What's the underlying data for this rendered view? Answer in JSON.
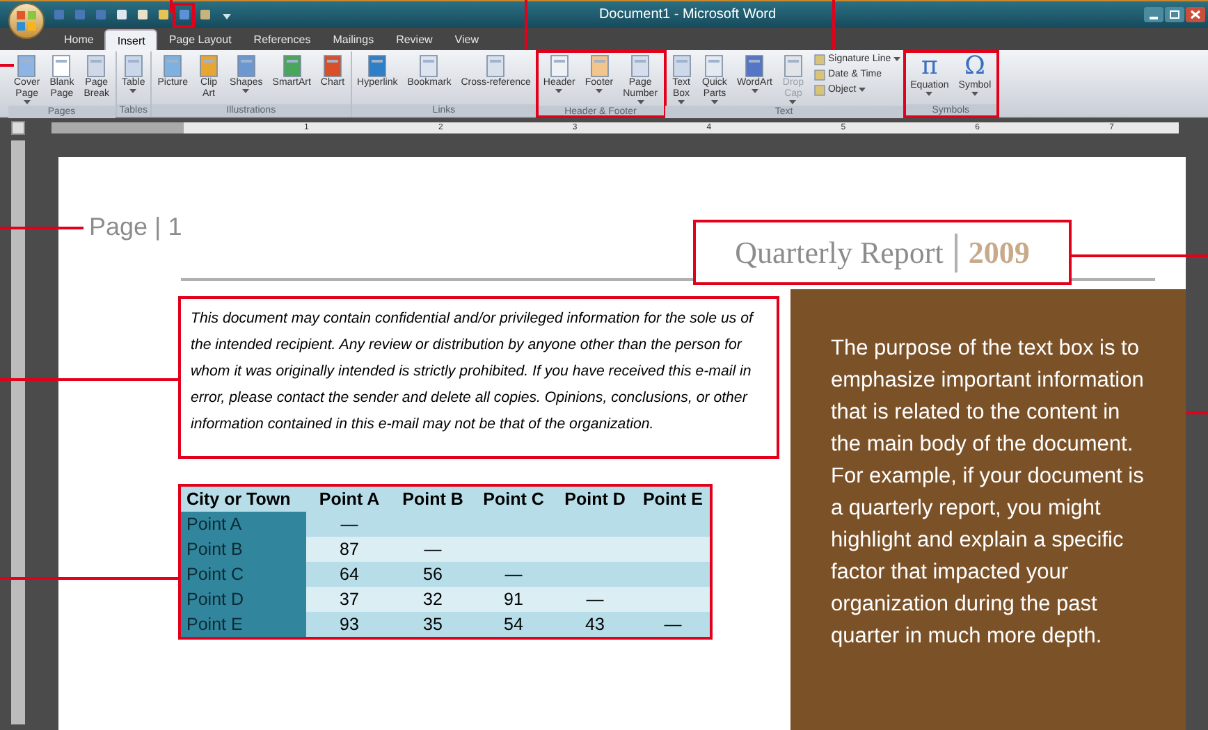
{
  "window": {
    "title": "Document1 - Microsoft Word"
  },
  "quick_access": [
    {
      "highlighted": false
    },
    {
      "highlighted": false
    },
    {
      "highlighted": false
    },
    {
      "highlighted": false
    },
    {
      "highlighted": false
    },
    {
      "highlighted": false
    },
    {
      "highlighted": true
    },
    {
      "highlighted": false
    }
  ],
  "tabs": [
    {
      "label": "Home",
      "selected": false
    },
    {
      "label": "Insert",
      "selected": true
    },
    {
      "label": "Page Layout",
      "selected": false
    },
    {
      "label": "References",
      "selected": false
    },
    {
      "label": "Mailings",
      "selected": false
    },
    {
      "label": "Review",
      "selected": false
    },
    {
      "label": "View",
      "selected": false
    }
  ],
  "ribbon": [
    {
      "name": "Pages",
      "highlighted": false,
      "buttons": [
        {
          "label": "Cover\nPage",
          "dropdown": true,
          "disabled": false
        },
        {
          "label": "Blank\nPage",
          "dropdown": false,
          "disabled": false
        },
        {
          "label": "Page\nBreak",
          "dropdown": false,
          "disabled": false
        }
      ]
    },
    {
      "name": "Tables",
      "highlighted": false,
      "buttons": [
        {
          "label": "Table",
          "dropdown": true,
          "disabled": false
        }
      ]
    },
    {
      "name": "Illustrations",
      "highlighted": false,
      "buttons": [
        {
          "label": "Picture",
          "dropdown": false,
          "disabled": false
        },
        {
          "label": "Clip\nArt",
          "dropdown": false,
          "disabled": false
        },
        {
          "label": "Shapes",
          "dropdown": true,
          "disabled": false
        },
        {
          "label": "SmartArt",
          "dropdown": false,
          "disabled": false
        },
        {
          "label": "Chart",
          "dropdown": false,
          "disabled": false
        }
      ]
    },
    {
      "name": "Links",
      "highlighted": false,
      "buttons": [
        {
          "label": "Hyperlink",
          "dropdown": false,
          "disabled": false
        },
        {
          "label": "Bookmark",
          "dropdown": false,
          "disabled": false
        },
        {
          "label": "Cross-reference",
          "dropdown": false,
          "disabled": false
        }
      ]
    },
    {
      "name": "Header & Footer",
      "highlighted": true,
      "buttons": [
        {
          "label": "Header",
          "dropdown": true,
          "disabled": false
        },
        {
          "label": "Footer",
          "dropdown": true,
          "disabled": false
        },
        {
          "label": "Page\nNumber",
          "dropdown": true,
          "disabled": false
        }
      ]
    },
    {
      "name": "Text",
      "highlighted": false,
      "buttons": [
        {
          "label": "Text\nBox",
          "dropdown": true,
          "disabled": false
        },
        {
          "label": "Quick\nParts",
          "dropdown": true,
          "disabled": false
        },
        {
          "label": "WordArt",
          "dropdown": true,
          "disabled": false
        },
        {
          "label": "Drop\nCap",
          "dropdown": true,
          "disabled": true
        }
      ],
      "small_buttons": [
        {
          "label": "Signature Line",
          "dropdown": true
        },
        {
          "label": "Date & Time",
          "dropdown": false
        },
        {
          "label": "Object",
          "dropdown": true
        }
      ]
    },
    {
      "name": "Symbols",
      "highlighted": true,
      "buttons": [
        {
          "label": "Equation",
          "glyph": "π",
          "dropdown": true,
          "disabled": false
        },
        {
          "label": "Symbol",
          "glyph": "Ω",
          "dropdown": true,
          "disabled": false
        }
      ]
    }
  ],
  "ruler": [
    "1",
    "2",
    "3",
    "4",
    "5",
    "6",
    "7"
  ],
  "document": {
    "header": {
      "text": "Page | 1",
      "highlighted": false
    },
    "title": {
      "text": "Quarterly Report",
      "year": "2009",
      "highlighted": true
    },
    "disclaimer": {
      "text": "This document may contain confidential and/or privileged information for the sole us of the intended recipient. Any review or distribution by anyone other than the person for whom it was originally intended is strictly prohibited. If you have received this e-mail in error, please contact the sender and delete all copies. Opinions, conclusions, or other information contained in this e-mail may not be that of the organization.",
      "highlighted": true
    },
    "table": {
      "highlighted": true,
      "columns": [
        "City or Town",
        "Point A",
        "Point B",
        "Point C",
        "Point D",
        "Point E"
      ],
      "rows": [
        [
          "Point A",
          "—"
        ],
        [
          "Point B",
          "87",
          "—"
        ],
        [
          "Point C",
          "64",
          "56",
          "—"
        ],
        [
          "Point D",
          "37",
          "32",
          "91",
          "—"
        ],
        [
          "Point E",
          "93",
          "35",
          "54",
          "43",
          "—"
        ]
      ]
    },
    "sidebar": {
      "text": "The purpose of the text box is to emphasize important information that is related to the content in the main body of the document. For example, if your document is a quarterly report, you might highlight and explain a specific factor that impacted your organization during the past quarter in much more depth."
    }
  }
}
